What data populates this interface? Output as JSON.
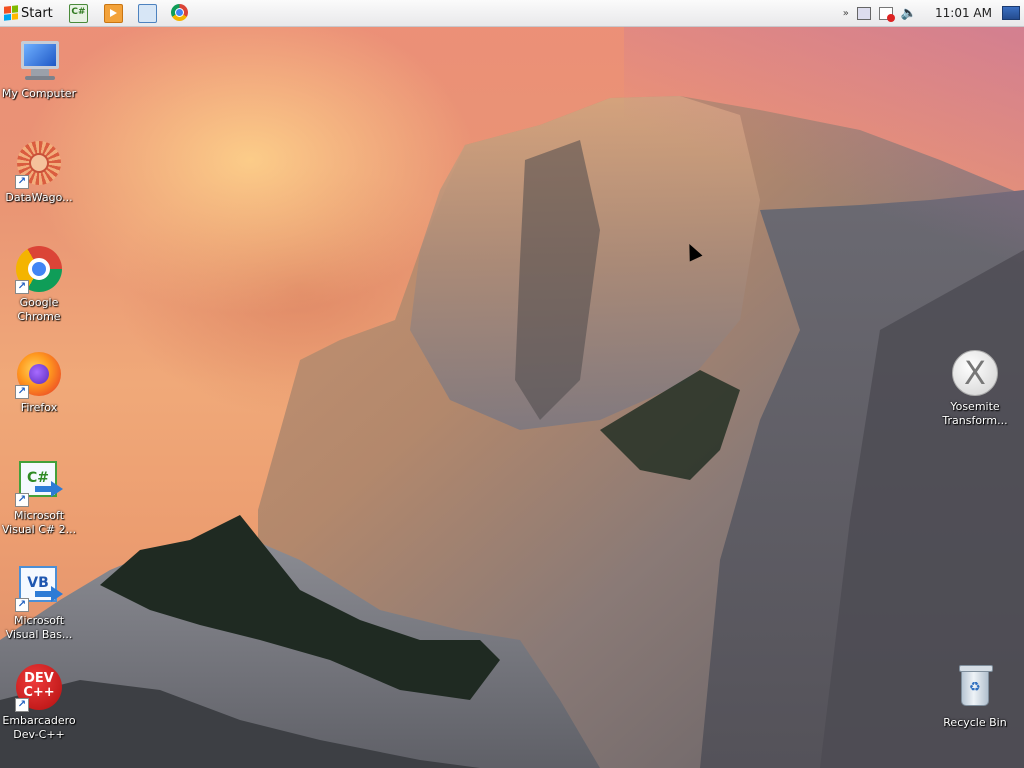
{
  "taskbar": {
    "start_label": "Start",
    "quick_launch": [
      {
        "name": "Microsoft Visual C# 2010 Express",
        "icon": "csharp-icon",
        "glyph": "C#"
      },
      {
        "name": "Media Player",
        "icon": "media-player-icon"
      },
      {
        "name": "Microsoft Visual Basic 2010 Express",
        "icon": "vb-icon"
      },
      {
        "name": "Google Chrome",
        "icon": "chrome-icon"
      }
    ],
    "tray": {
      "chevron": "»",
      "volume_glyph": "🔈",
      "clock": "11:01 AM"
    }
  },
  "desktop": {
    "left_icons": [
      {
        "label": "My Computer",
        "icon": "my-computer-icon"
      },
      {
        "label": "DataWago...",
        "icon": "datawagon-icon",
        "shortcut": true
      },
      {
        "label": "Google Chrome",
        "icon": "chrome-icon",
        "shortcut": true
      },
      {
        "label": "Firefox",
        "icon": "firefox-icon",
        "shortcut": true
      },
      {
        "label": "Microsoft Visual C# 2...",
        "icon": "visual-csharp-icon",
        "glyph": "C#",
        "shortcut": true
      },
      {
        "label": "Microsoft Visual Bas...",
        "icon": "visual-basic-icon",
        "glyph": "VB",
        "shortcut": true
      },
      {
        "label": "Embarcadero Dev-C++",
        "icon": "devcpp-icon",
        "glyph": "DEV C++",
        "shortcut": true
      }
    ],
    "right_icons": [
      {
        "label": "Yosemite Transform...",
        "icon": "yosemite-transformation-icon",
        "glyph": "X"
      },
      {
        "label": "Recycle Bin",
        "icon": "recycle-bin-icon"
      }
    ],
    "shortcut_glyph": "↗",
    "colors": {
      "sky_top": "#ec8f78",
      "sky_glow": "#ffd68c",
      "rock_light": "#c99572",
      "rock_dark": "#5a5550",
      "forest": "#1f2a22"
    }
  }
}
